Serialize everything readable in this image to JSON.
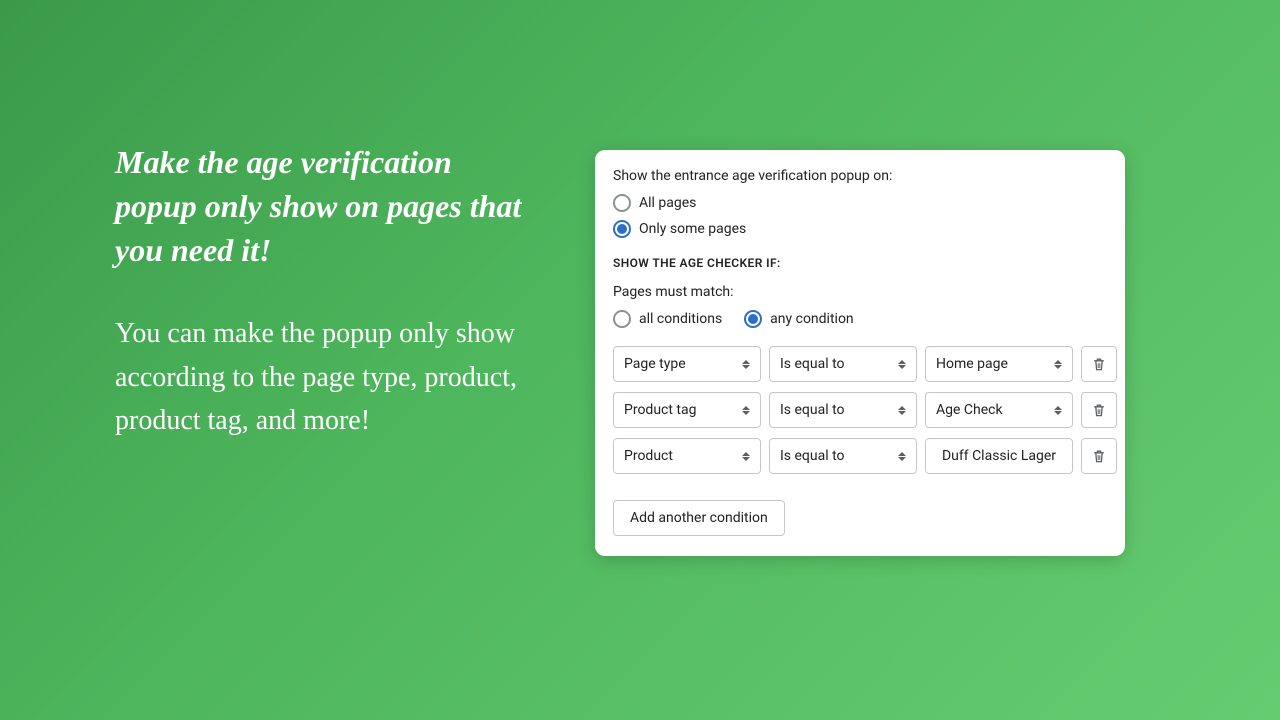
{
  "promo": {
    "headline": "Make the age verification popup only show on pages that you need it!",
    "subtext": "You can make the popup only show according to the page type, product, product tag, and more!"
  },
  "card": {
    "show_label": "Show the entrance age verification popup on:",
    "radio_all": "All pages",
    "radio_some": "Only some pages",
    "show_selection": "some",
    "section_title": "Show the age checker if:",
    "match_label": "Pages must match:",
    "match_all": "all conditions",
    "match_any": "any condition",
    "match_selection": "any",
    "rules": [
      {
        "field": "Page type",
        "op": "Is equal to",
        "value": "Home page",
        "value_kind": "select"
      },
      {
        "field": "Product tag",
        "op": "Is equal to",
        "value": "Age Check",
        "value_kind": "select"
      },
      {
        "field": "Product",
        "op": "Is equal to",
        "value": "Duff Classic Lager",
        "value_kind": "text"
      }
    ],
    "add_label": "Add another condition"
  }
}
